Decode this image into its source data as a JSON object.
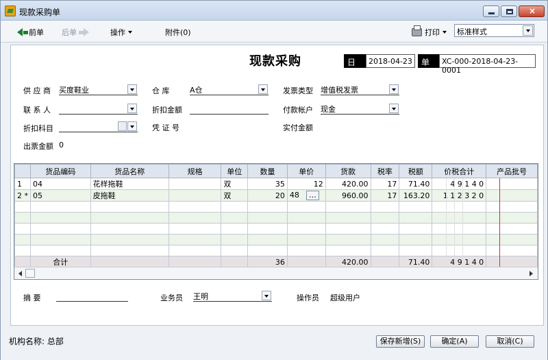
{
  "window": {
    "title": "现款采购单"
  },
  "toolbar": {
    "prev": "前单",
    "next": "后单",
    "operation": "操作",
    "attachment": "附件(0)",
    "print": "打印",
    "style_value": "标准样式"
  },
  "form": {
    "title": "现款采购",
    "date_label": "日期",
    "date_value": "2018-04-23",
    "number_label": "单号",
    "number_value": "XC-000-2018-04-23-0001",
    "supplier_label": "供 应 商",
    "supplier_value": "买度鞋业",
    "warehouse_label": "仓   库",
    "warehouse_value": "A仓",
    "invoice_type_label": "发票类型",
    "invoice_type_value": "增值税发票",
    "contact_label": "联 系 人",
    "discount_amount_label": "折扣金额",
    "payment_account_label": "付款帐户",
    "payment_account_value": "现金",
    "discount_subject_label": "折扣科目",
    "voucher_label": "凭 证 号",
    "actual_amount_label": "实付金额",
    "invoice_amount_label": "出票金额",
    "invoice_amount_value": "0",
    "summary_label": "摘   要",
    "salesperson_label": "业务员",
    "salesperson_value": "王明",
    "operator_label": "操作员",
    "operator_value": "超级用户"
  },
  "grid": {
    "columns": [
      "货品编码",
      "货品名称",
      "规格",
      "单位",
      "数量",
      "单价",
      "货款",
      "税率",
      "税额",
      "价税合计",
      "产品批号"
    ],
    "rows": [
      {
        "rowhead": "1",
        "code": "04",
        "name": "花样拖鞋",
        "spec": "",
        "unit": "双",
        "qty": "35",
        "price": "12",
        "amount": "420.00",
        "tax_rate": "17",
        "tax_amount": "71.40",
        "total": "4 9 1 4 0",
        "batch": ""
      },
      {
        "rowhead": "2 *",
        "code": "05",
        "name": "皮拖鞋",
        "spec": "",
        "unit": "双",
        "qty": "20",
        "price": "48",
        "amount": "960.00",
        "tax_rate": "17",
        "tax_amount": "163.20",
        "total": "1 1 2 3 2 0",
        "batch": ""
      }
    ],
    "summary": {
      "label": "合计",
      "qty": "36",
      "amount": "420.00",
      "tax_amount": "71.40",
      "total": "4 9 1 4 0"
    }
  },
  "footer": {
    "org_label": "机构名称:",
    "org_value": "总部",
    "save_new": "保存新增(S)",
    "confirm": "确定(A)",
    "cancel": "取消(C)"
  },
  "colors": {
    "title_bar": "#c5d6ec",
    "grid_even_row": "#edf4e9",
    "summary_row": "#e8e1e4",
    "tax_divider": "#c63232"
  }
}
